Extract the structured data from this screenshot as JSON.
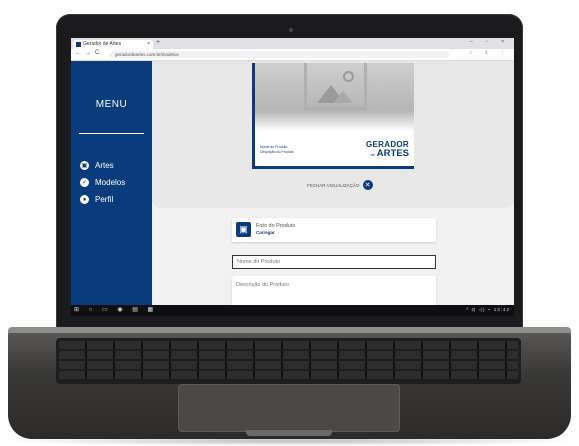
{
  "browser": {
    "tab_title": "Gerador de Artes",
    "tab_close": "×",
    "new_tab": "+",
    "window_controls": "– ▫ ×",
    "nav_buttons": [
      "←",
      "→",
      "C"
    ],
    "url": "geradordeartes.com.br/modelos",
    "address_icons": "☆ ⇩ ⋮"
  },
  "sidebar": {
    "title": "MENU",
    "items": [
      {
        "label": "Artes",
        "icon": "image-icon",
        "glyph": "▣"
      },
      {
        "label": "Modelos",
        "icon": "check-icon",
        "glyph": "✓"
      },
      {
        "label": "Perfil",
        "icon": "user-icon",
        "glyph": "●"
      }
    ]
  },
  "preview": {
    "small_text_1": "Nome do Produto",
    "small_text_2": "Descrição do Produto",
    "brand_line1": "GERADOR",
    "brand_of": "de",
    "brand_line2": "ARTES",
    "tool_label": "FECHAR VISUALIZAÇÃO",
    "tool_glyph": "✕"
  },
  "form": {
    "upload_title": "Foto do Produto",
    "upload_sub": "Carregar",
    "upload_glyph": "🖼",
    "name_placeholder": "Nome do Produto",
    "desc_placeholder": "Descrição do Produto"
  },
  "taskbar": {
    "left_icons": "⊞ ○ ▭ ◉ ▤ ▦",
    "tray": "^ ⊡ ◁) ⌁  13:42"
  },
  "colors": {
    "brand_blue": "#0a3b7d",
    "background": "#f1f1f1"
  }
}
